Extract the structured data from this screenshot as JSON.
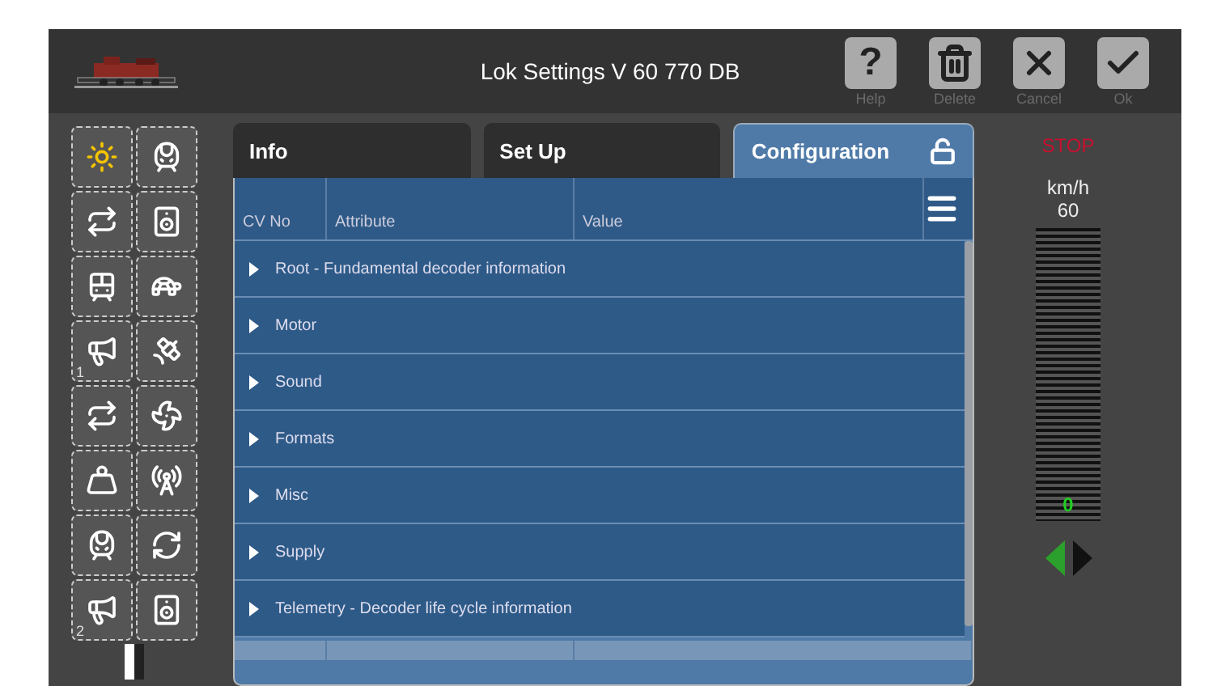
{
  "window": {
    "title": "Lok Settings V 60 770 DB"
  },
  "header_buttons": [
    {
      "kind": "help",
      "symbol": "?",
      "label": "Help"
    },
    {
      "kind": "delete",
      "label": "Delete"
    },
    {
      "kind": "cancel",
      "label": "Cancel"
    },
    {
      "kind": "ok",
      "label": "Ok"
    }
  ],
  "functions": [
    {
      "kind": "light",
      "on": true
    },
    {
      "kind": "train",
      "on": false
    },
    {
      "kind": "couple",
      "on": false
    },
    {
      "kind": "speaker",
      "on": false
    },
    {
      "kind": "tram",
      "on": false
    },
    {
      "kind": "turtle",
      "on": false
    },
    {
      "kind": "horn",
      "on": false,
      "number": "1"
    },
    {
      "kind": "satellite",
      "on": false
    },
    {
      "kind": "couple",
      "on": false
    },
    {
      "kind": "fan",
      "on": false
    },
    {
      "kind": "weight",
      "on": false
    },
    {
      "kind": "tower",
      "on": false
    },
    {
      "kind": "train",
      "on": false
    },
    {
      "kind": "refresh",
      "on": false
    },
    {
      "kind": "horn",
      "on": false,
      "number": "2"
    },
    {
      "kind": "speaker",
      "on": false
    }
  ],
  "tabs": [
    {
      "label": "Info",
      "selected": false
    },
    {
      "label": "Set Up",
      "selected": false
    },
    {
      "label": "Configuration",
      "selected": true,
      "locked": false
    }
  ],
  "table": {
    "columns": [
      "CV No",
      "Attribute",
      "Value"
    ],
    "rows": [
      {
        "label": "Root - Fundamental decoder information",
        "expanded": false
      },
      {
        "label": "Motor",
        "expanded": false
      },
      {
        "label": "Sound",
        "expanded": false
      },
      {
        "label": "Formats",
        "expanded": false
      },
      {
        "label": "Misc",
        "expanded": false
      },
      {
        "label": "Supply",
        "expanded": false
      },
      {
        "label": "Telemetry - Decoder life cycle information",
        "expanded": false
      }
    ]
  },
  "control": {
    "status": "STOP",
    "unit": "km/h",
    "max": "60",
    "speed": {
      "level": 0,
      "reading": "0"
    },
    "directions": [
      {
        "selected": true
      },
      {
        "selected": false
      }
    ]
  }
}
